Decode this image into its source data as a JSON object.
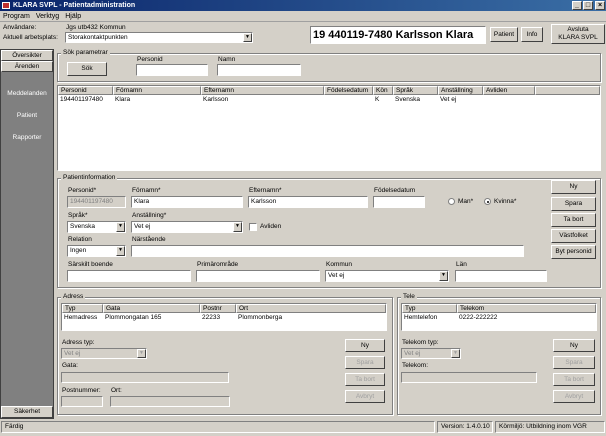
{
  "window": {
    "title": "KLARA SVPL - Patientadministration"
  },
  "menu": [
    "Program",
    "Verktyg",
    "Hjälp"
  ],
  "header": {
    "user_label": "Användare:",
    "user_value": "Jgs utb432 Kommun",
    "workplace_label": "Aktuell arbetsplats:",
    "workplace_value": "Storakontaktpunkten",
    "patient_banner": "19 440119-7480 Karlsson Klara",
    "patient_button": "Patient",
    "info_button": "Info",
    "exit_button_line1": "Avsluta",
    "exit_button_line2": "KLARA SVPL"
  },
  "sidebar": {
    "tab_overview": "Översikter",
    "tab_units": "Ärenden",
    "items": [
      "Meddelanden",
      "Patient",
      "Rapporter"
    ],
    "bottom_tab": "Säkerhet"
  },
  "search": {
    "group_label": "Sök parametrar",
    "search_button": "Sök",
    "personid_label": "Personid",
    "personid_value": "",
    "name_label": "Namn",
    "name_value": ""
  },
  "results": {
    "columns": [
      "Personid",
      "Förnamn",
      "Efternamn",
      "Födelsedatum",
      "Kön",
      "Språk",
      "Anställning",
      "Avliden"
    ],
    "rows": [
      [
        "194401197480",
        "Klara",
        "Karlsson",
        "",
        "K",
        "Svenska",
        "Vet ej",
        ""
      ]
    ]
  },
  "patientinfo": {
    "group_label": "Patientinformation",
    "personid_label": "Personid*",
    "personid_value": "194401197480",
    "firstname_label": "Förnamn*",
    "firstname_value": "Klara",
    "lastname_label": "Efternamn*",
    "lastname_value": "Karlsson",
    "birthdate_label": "Födelsedatum",
    "birthdate_value": "",
    "male_label": "Man*",
    "female_label": "Kvinna*",
    "gender_selected": "Kvinna",
    "language_label": "Språk*",
    "language_value": "Svenska",
    "employment_label": "Anställning*",
    "employment_value": "Vet ej",
    "deceased_label": "Avliden",
    "relation_label": "Relation",
    "relation_value": "Ingen",
    "relative_label": "Närstående",
    "relative_value": "",
    "special_label": "Särskilt boende",
    "special_value": "",
    "primary_label": "Primärområde",
    "primary_value": "",
    "municipality_label": "Kommun",
    "municipality_value": "Vet ej",
    "county_label": "Län",
    "county_value": "",
    "buttons": [
      "Ny",
      "Spara",
      "Ta bort",
      "Västfolket",
      "Byt personid"
    ]
  },
  "address": {
    "group_label": "Adress",
    "columns": [
      "Typ",
      "Gata",
      "Postnr",
      "Ort"
    ],
    "rows": [
      [
        "Hemadress",
        "Plommongatan 165",
        "22233",
        "Plommonberga"
      ]
    ],
    "type_label": "Adress typ:",
    "type_value": "Vet ej",
    "street_label": "Gata:",
    "postal_label": "Postnummer:",
    "city_label": "Ort:",
    "buttons": [
      "Ny",
      "Spara",
      "Ta bort",
      "Avbryt"
    ]
  },
  "phone": {
    "group_label": "Tele",
    "columns": [
      "Typ",
      "Telekom"
    ],
    "rows": [
      [
        "Hemtelefon",
        "0222-222222"
      ]
    ],
    "type_label": "Telekom typ:",
    "type_value": "Vet ej",
    "number_label": "Telekom:",
    "buttons": [
      "Ny",
      "Spara",
      "Ta bort",
      "Avbryt"
    ]
  },
  "status": {
    "left": "Färdig",
    "version": "Version: 1.4.0.10",
    "environment": "Körmiljö: Utbildning inom VGR"
  }
}
